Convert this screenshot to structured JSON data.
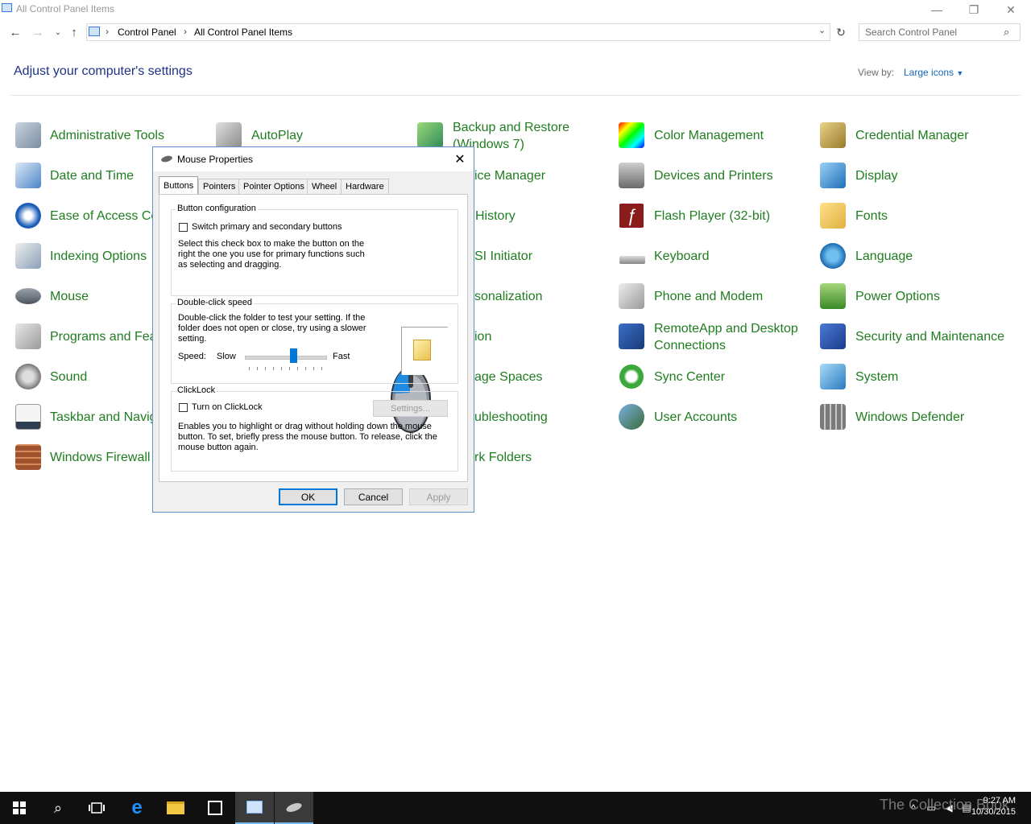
{
  "window": {
    "title": "All Control Panel Items",
    "minimize_glyph": "—",
    "restore_glyph": "❐",
    "close_glyph": "✕"
  },
  "address_bar": {
    "crumbs": [
      "Control Panel",
      "All Control Panel Items"
    ],
    "search_placeholder": "Search Control Panel"
  },
  "header": {
    "title": "Adjust your computer's settings",
    "view_by_label": "View by:",
    "view_by_value": "Large icons"
  },
  "items": {
    "c1": [
      "Administrative Tools",
      "Date and Time",
      "Ease of Access Cer",
      "Indexing Options",
      "Mouse",
      "Programs and Feat",
      "Sound",
      "Taskbar and Navig",
      "Windows Firewall"
    ],
    "c2_top": [
      "AutoPlay"
    ],
    "c3": [
      "Backup and Restore",
      "(Windows 7)",
      "ice Manager",
      "History",
      "SI Initiator",
      "sonalization",
      "ion",
      "age Spaces",
      "ubleshooting",
      "rk Folders"
    ],
    "c4": [
      "Color Management",
      "Devices and Printers",
      "Flash Player (32-bit)",
      "Keyboard",
      "Phone and Modem",
      "RemoteApp and Desktop",
      "Connections",
      "Sync Center",
      "User Accounts"
    ],
    "c5": [
      "Credential Manager",
      "Display",
      "Fonts",
      "Language",
      "Power Options",
      "Security and Maintenance",
      "System",
      "Windows Defender"
    ]
  },
  "dialog": {
    "title": "Mouse Properties",
    "tabs": [
      "Buttons",
      "Pointers",
      "Pointer Options",
      "Wheel",
      "Hardware"
    ],
    "button_config": {
      "title": "Button configuration",
      "checkbox_label": "Switch primary and secondary buttons",
      "line1": "Select this check box to make the button on the",
      "line2": "right the one you use for primary functions such",
      "line3": "as selecting and dragging."
    },
    "double_click": {
      "title": "Double-click speed",
      "line1": "Double-click the folder to test your setting. If the",
      "line2": "folder does not open or close, try using a slower",
      "line3": "setting.",
      "speed_label": "Speed:",
      "slow": "Slow",
      "fast": "Fast",
      "slider_value": 0.6
    },
    "clicklock": {
      "title": "ClickLock",
      "checkbox_label": "Turn on ClickLock",
      "settings_button": "Settings...",
      "line1": "Enables you to highlight or drag without holding down the mouse",
      "line2": "button. To set, briefly press the mouse button. To release, click the",
      "line3": "mouse button again."
    },
    "ok": "OK",
    "cancel": "Cancel",
    "apply": "Apply"
  },
  "taskbar": {
    "time": "9:27 AM",
    "date": "10/30/2015",
    "watermark": "The Collection Book"
  },
  "colors": {
    "link_green": "#1f7d1f",
    "title_blue": "#1e3287",
    "accent": "#0078d7"
  }
}
